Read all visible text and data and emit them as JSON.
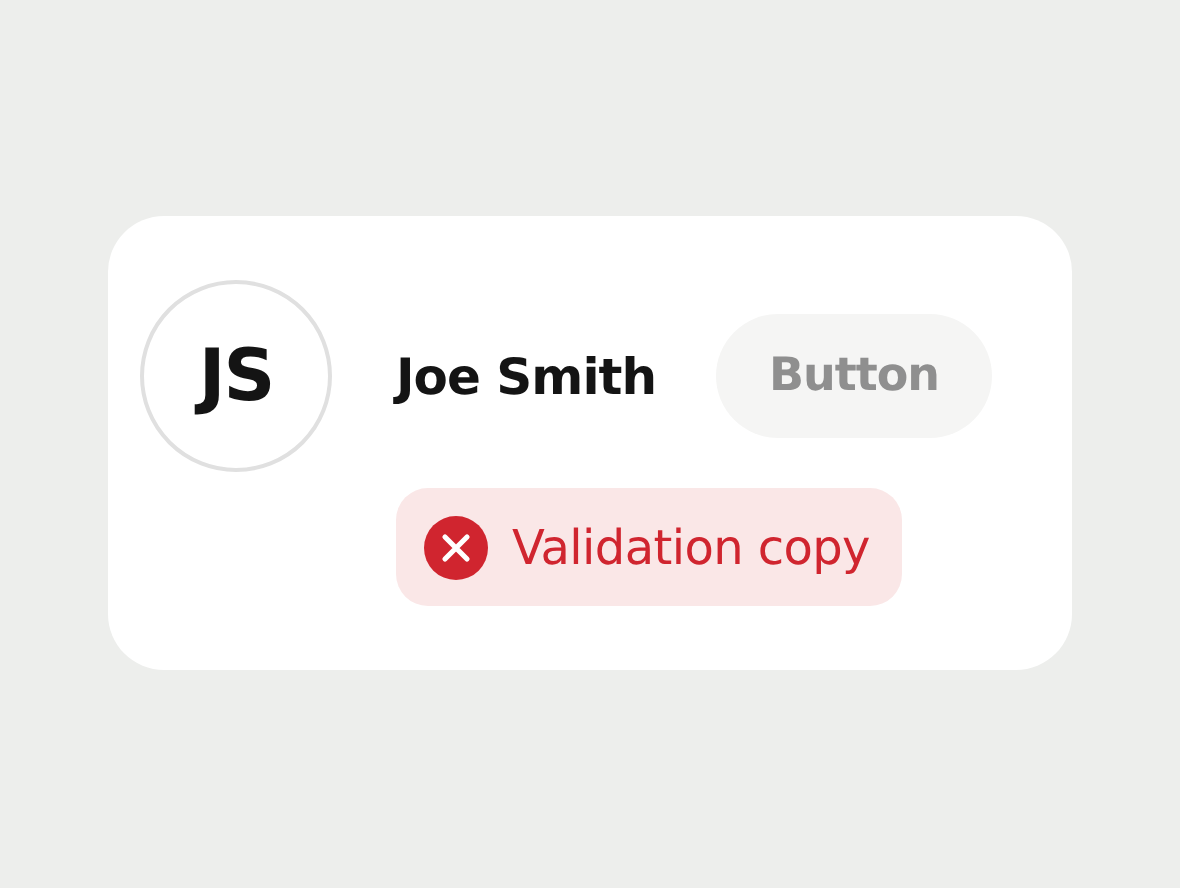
{
  "avatar": {
    "initials": "JS"
  },
  "user": {
    "name": "Joe Smith"
  },
  "button": {
    "label": "Button",
    "disabled": true
  },
  "validation": {
    "kind": "error",
    "text": "Validation copy"
  }
}
